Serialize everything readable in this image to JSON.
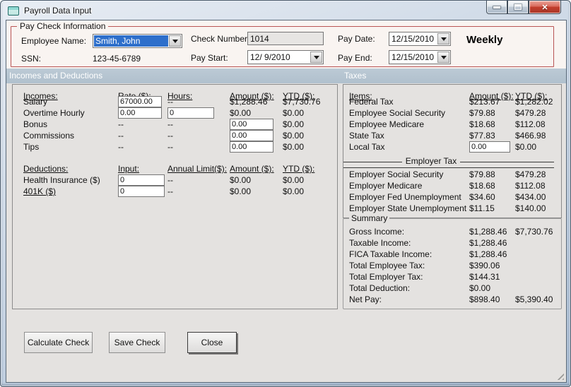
{
  "window": {
    "title": "Payroll Data Input"
  },
  "icons": {
    "close": "✕"
  },
  "colors": {
    "groupbox_border": "#b95454",
    "section_bar": "#b5c4d0",
    "selection_blue": "#2e6fcb",
    "close_button_red": "#c23d2c"
  },
  "paycheck": {
    "legend": "Pay Check Information",
    "employee_name": {
      "label": "Employee Name:",
      "value": "Smith, John"
    },
    "ssn": {
      "label": "SSN:",
      "value": "123-45-6789"
    },
    "check_number": {
      "label": "Check Number:",
      "value": "1014"
    },
    "pay_start": {
      "label": "Pay Start:",
      "value": "12/ 9/2010"
    },
    "pay_date": {
      "label": "Pay Date:",
      "value": "12/15/2010"
    },
    "pay_end": {
      "label": "Pay End:",
      "value": "12/15/2010"
    },
    "frequency": "Weekly"
  },
  "section_bar": {
    "left": "Incomes and Deductions",
    "right": "Taxes"
  },
  "incomes": {
    "headers": {
      "item": "Incomes:",
      "rate": "Rate ($):",
      "hours": "Hours:",
      "amount": "Amount ($):",
      "ytd": "YTD ($):"
    },
    "rows": [
      {
        "label": "Salary",
        "rate": "67000.00",
        "hours": "--",
        "amount": "$1,288.46",
        "ytd": "$7,730.76"
      },
      {
        "label": "Overtime Hourly",
        "rate": "0.00",
        "hours": "0",
        "amount": "$0.00",
        "ytd": "$0.00"
      },
      {
        "label": "Bonus",
        "rate": "--",
        "hours": "--",
        "amount": "0.00",
        "ytd": "$0.00"
      },
      {
        "label": "Commissions",
        "rate": "--",
        "hours": "--",
        "amount": "0.00",
        "ytd": "$0.00"
      },
      {
        "label": "Tips",
        "rate": "--",
        "hours": "--",
        "amount": "0.00",
        "ytd": "$0.00"
      }
    ]
  },
  "deductions": {
    "headers": {
      "item": "Deductions:",
      "input": "Input:",
      "limit": "Annual Limit($):",
      "amount": "Amount ($):",
      "ytd": "YTD ($):"
    },
    "rows": [
      {
        "label": "Health Insurance  ($)",
        "input": "0",
        "limit": "--",
        "amount": "$0.00",
        "ytd": "$0.00"
      },
      {
        "label": "401K  ($)",
        "input": "0",
        "limit": "--",
        "amount": "$0.00",
        "ytd": "$0.00"
      }
    ]
  },
  "taxes": {
    "headers": {
      "item": "Items:",
      "amount": "Amount ($):",
      "ytd": "YTD ($):"
    },
    "employee_rows": [
      {
        "label": "Federal Tax",
        "amount": "$213.67",
        "ytd": "$1,282.02"
      },
      {
        "label": "Employee Social Security",
        "amount": "$79.88",
        "ytd": "$479.28"
      },
      {
        "label": "Employee Medicare",
        "amount": "$18.68",
        "ytd": "$112.08"
      },
      {
        "label": "State Tax",
        "amount": "$77.83",
        "ytd": "$466.98"
      },
      {
        "label": "Local Tax",
        "amount": "0.00",
        "ytd": "$0.00"
      }
    ],
    "employer_header": "Employer Tax",
    "employer_rows": [
      {
        "label": "Employer Social Security",
        "amount": "$79.88",
        "ytd": "$479.28"
      },
      {
        "label": "Employer Medicare",
        "amount": "$18.68",
        "ytd": "$112.08"
      },
      {
        "label": "Employer Fed Unemployment",
        "amount": "$34.60",
        "ytd": "$434.00"
      },
      {
        "label": "Employer State Unemployment",
        "amount": "$11.15",
        "ytd": "$140.00"
      }
    ]
  },
  "summary": {
    "legend": "Summary",
    "rows": [
      {
        "label": "Gross Income:",
        "amount": "$1,288.46",
        "ytd": "$7,730.76"
      },
      {
        "label": "Taxable Income:",
        "amount": "$1,288.46",
        "ytd": ""
      },
      {
        "label": "FICA Taxable Income:",
        "amount": "$1,288.46",
        "ytd": ""
      },
      {
        "label": "Total Employee Tax:",
        "amount": "$390.06",
        "ytd": ""
      },
      {
        "label": "Total Employer Tax:",
        "amount": "$144.31",
        "ytd": ""
      },
      {
        "label": "Total Deduction:",
        "amount": "$0.00",
        "ytd": ""
      },
      {
        "label": "Net Pay:",
        "amount": "$898.40",
        "ytd": "$5,390.40"
      }
    ]
  },
  "buttons": {
    "calculate": "Calculate Check",
    "save": "Save Check",
    "close": "Close"
  }
}
